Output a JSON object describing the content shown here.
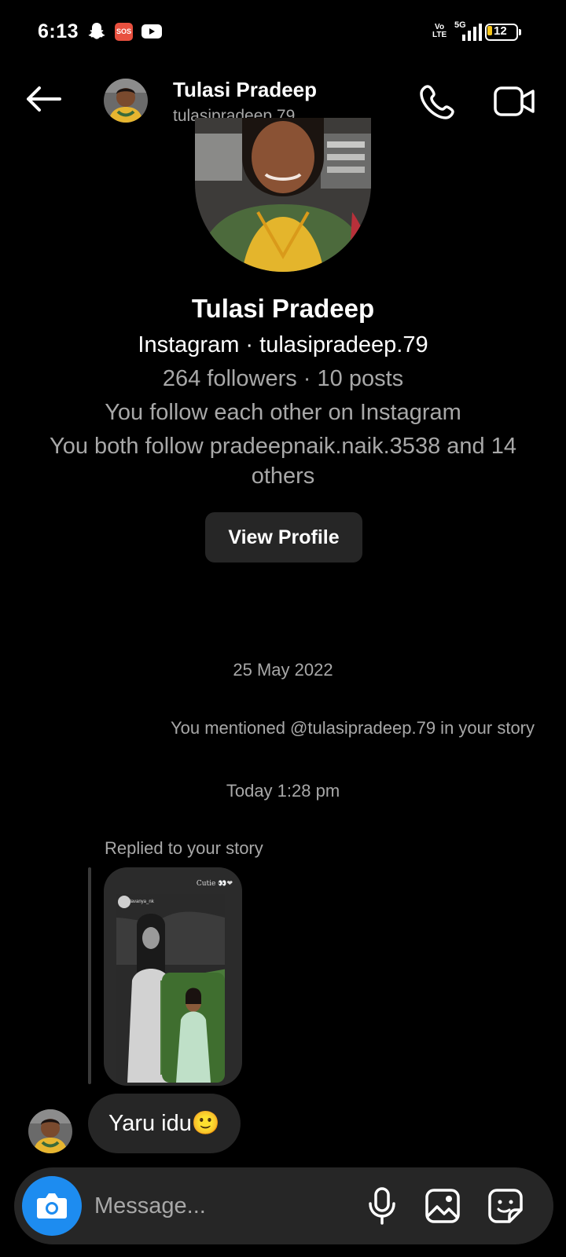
{
  "status_bar": {
    "time": "6:13",
    "sos_label": "SOS",
    "volte_top": "Vo",
    "volte_bottom": "LTE",
    "network": "5G",
    "battery_level": "12",
    "battery_color": "#f6c51a"
  },
  "header": {
    "name": "Tulasi Pradeep",
    "username": "tulasipradeep.79",
    "icons": [
      "back-arrow-icon",
      "phone-icon",
      "video-camera-icon"
    ]
  },
  "profile": {
    "name": "Tulasi Pradeep",
    "platform_line": "Instagram · tulasipradeep.79",
    "stats_line": "264 followers · 10 posts",
    "mutual_line": "You follow each other on Instagram",
    "common_line": "You both follow pradeepnaik.naik.3538 and 14 others",
    "view_profile_label": "View Profile"
  },
  "thread": {
    "date_1": "25 May 2022",
    "mention_text": "You mentioned @tulasipradeep.79 in your story",
    "date_2": "Today 1:28 pm",
    "replied_label": "Replied to your story",
    "story_caption": "Cutie 👀❤",
    "story_user": "_lavanya_nk",
    "message_text": "Yaru idu🙂"
  },
  "composer": {
    "placeholder": "Message...",
    "accent_color": "#1d8cf0",
    "icons": [
      "camera-icon",
      "microphone-icon",
      "gallery-icon",
      "sticker-icon"
    ]
  }
}
